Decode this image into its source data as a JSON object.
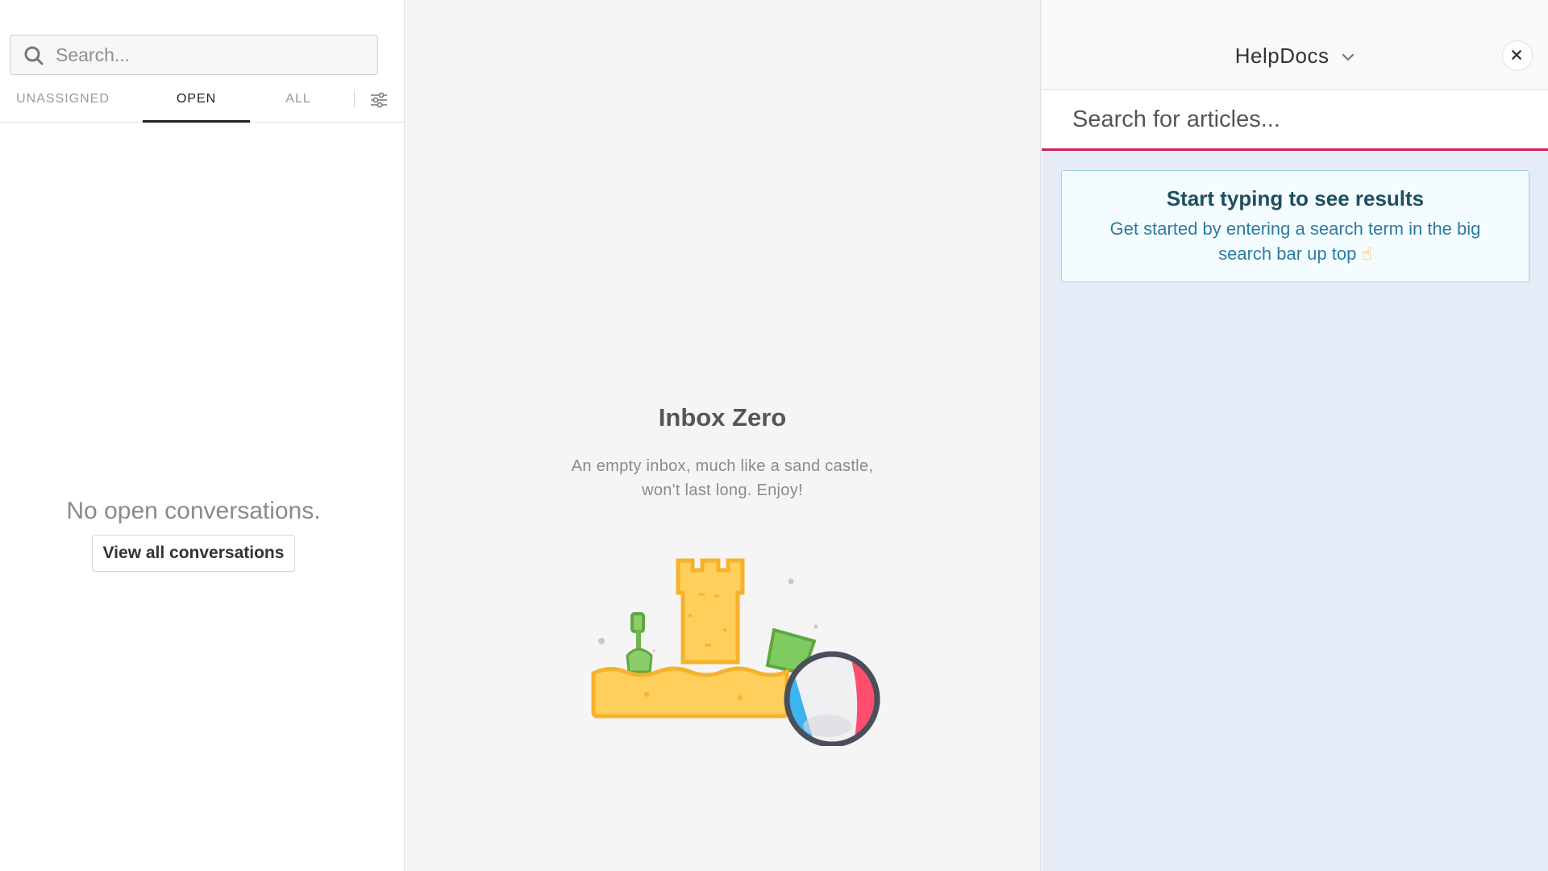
{
  "sidebar": {
    "search": {
      "placeholder": "Search..."
    },
    "tabs": [
      {
        "label": "UNASSIGNED",
        "active": false
      },
      {
        "label": "OPEN",
        "active": true
      },
      {
        "label": "ALL",
        "active": false
      }
    ],
    "empty_message": "No open conversations.",
    "view_all_label": "View all conversations"
  },
  "main": {
    "title": "Inbox Zero",
    "description": "An empty inbox, much like a sand castle, won't last long. Enjoy!"
  },
  "helpdocs": {
    "brand": "HelpDocs",
    "search_placeholder": "Search for articles...",
    "hint_title": "Start typing to see results",
    "hint_body": "Get started by entering a search term in the big search bar up top",
    "hint_emoji": "☝"
  },
  "colors": {
    "accent": "#d4214f",
    "hint_title": "#1d4f60",
    "hint_body": "#2a7da0",
    "panel_bg": "#e6ecf7"
  },
  "icons": [
    "search-icon",
    "filter-icon",
    "chevron-down-icon",
    "close-icon"
  ]
}
